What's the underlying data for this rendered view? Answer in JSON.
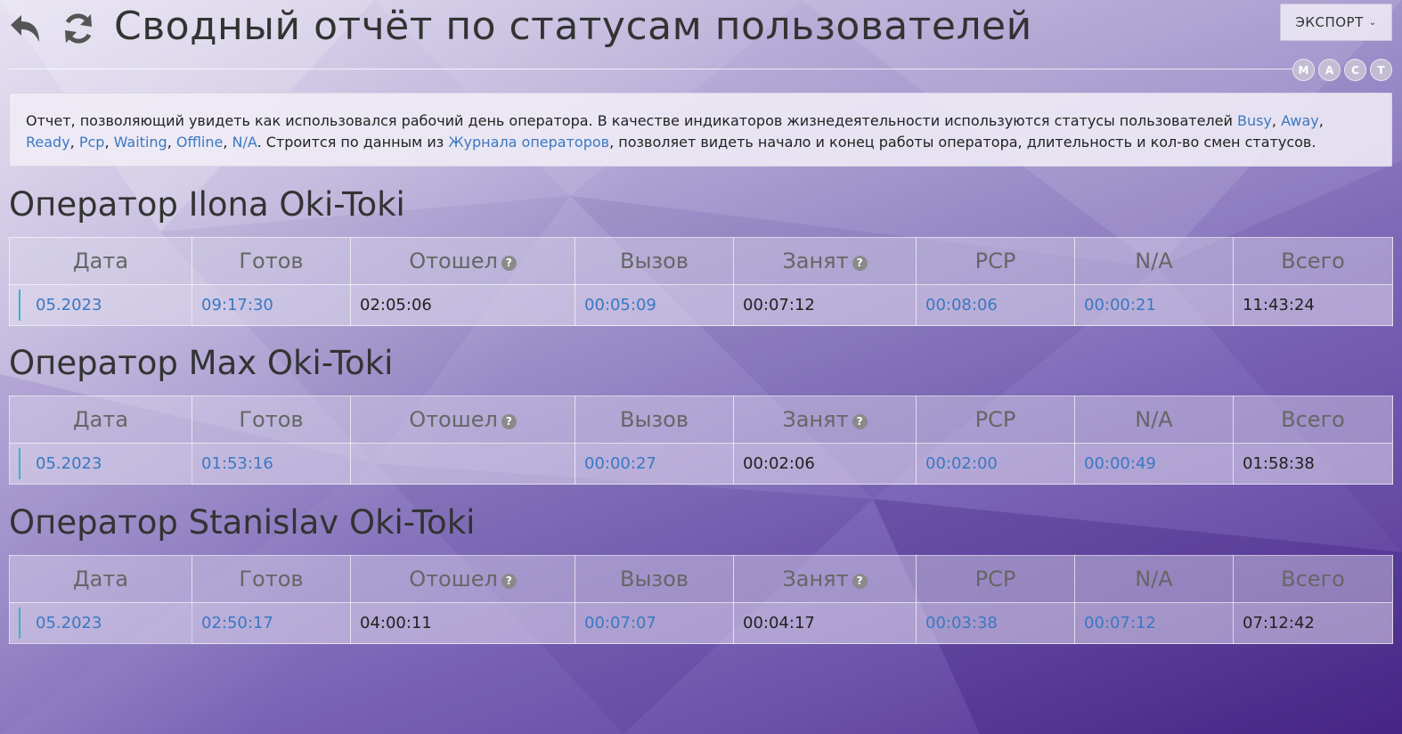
{
  "header": {
    "title": "Сводный отчёт по статусам пользователей",
    "export_label": "ЭКСПОРТ",
    "mini_buttons": [
      "M",
      "A",
      "C",
      "T"
    ]
  },
  "description": {
    "text1": "Отчет, позволяющий увидеть как использовался рабочий день оператора. В качестве индикаторов жизнедеятельности используются статусы пользователей ",
    "statuses": [
      "Busy",
      "Away",
      "Ready",
      "Pcp",
      "Waiting",
      "Offline",
      "N/A"
    ],
    "text2": ". Строится по данным из ",
    "journal_link": "Журнала операторов",
    "text3": ", позволяет видеть начало и конец работы оператора, длительность и кол-во смен статусов."
  },
  "columns": [
    "Дата",
    "Готов",
    "Отошел",
    "Вызов",
    "Занят",
    "PCP",
    "N/A",
    "Всего"
  ],
  "operators": [
    {
      "title": "Оператор Ilona Oki-Toki",
      "row": {
        "date": "05.2023",
        "ready": "09:17:30",
        "away": "02:05:06",
        "call": "00:05:09",
        "busy": "00:07:12",
        "pcp": "00:08:06",
        "na": "00:00:21",
        "total": "11:43:24"
      }
    },
    {
      "title": "Оператор Max Oki-Toki",
      "row": {
        "date": "05.2023",
        "ready": "01:53:16",
        "away": "",
        "call": "00:00:27",
        "busy": "00:02:06",
        "pcp": "00:02:00",
        "na": "00:00:49",
        "total": "01:58:38"
      }
    },
    {
      "title": "Оператор Stanislav Oki-Toki",
      "row": {
        "date": "05.2023",
        "ready": "02:50:17",
        "away": "04:00:11",
        "call": "00:07:07",
        "busy": "00:04:17",
        "pcp": "00:03:38",
        "na": "00:07:12",
        "total": "07:12:42"
      }
    }
  ]
}
